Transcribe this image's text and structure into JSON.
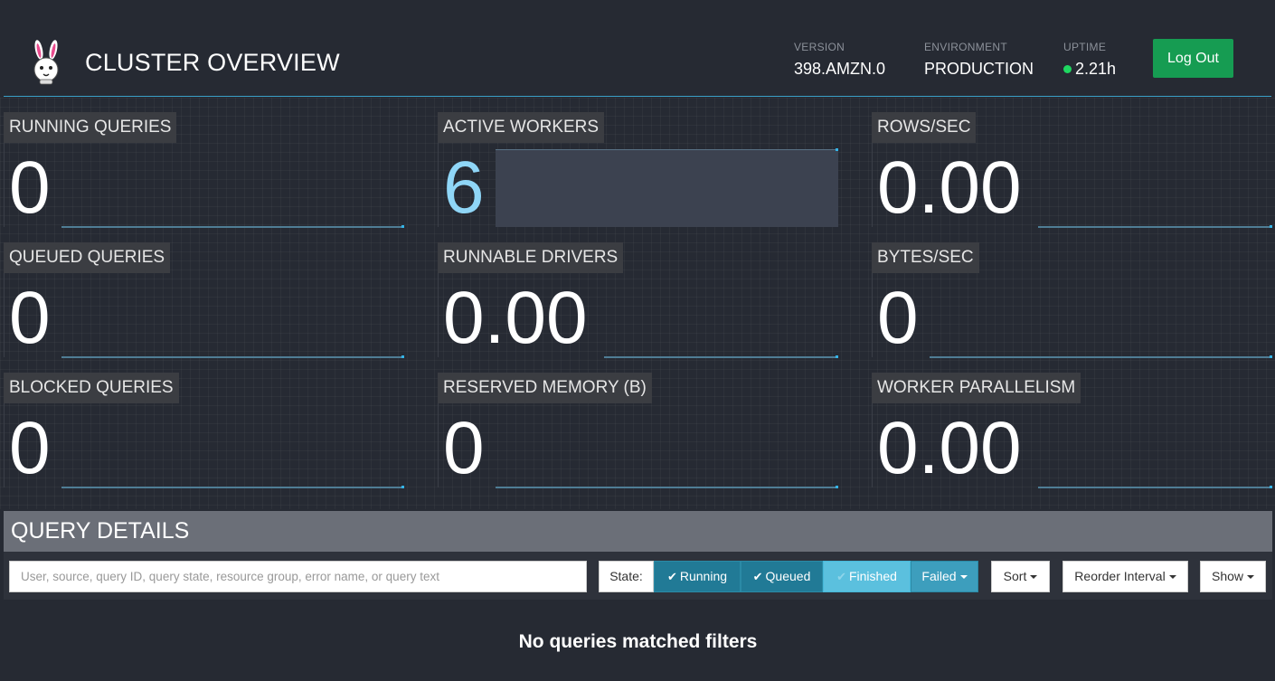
{
  "header": {
    "title": "CLUSTER OVERVIEW",
    "version_label": "VERSION",
    "version_value": "398.AMZN.0",
    "environment_label": "ENVIRONMENT",
    "environment_value": "PRODUCTION",
    "uptime_label": "UPTIME",
    "uptime_value": "2.21h",
    "logout_label": "Log Out",
    "colors": {
      "accent_rule": "#3aa0c8",
      "logout": "#169c52",
      "uptime_dot": "#1ed760"
    }
  },
  "tiles": {
    "running_queries": {
      "label": "RUNNING QUERIES",
      "value": "0"
    },
    "active_workers": {
      "label": "ACTIVE WORKERS",
      "value": "6"
    },
    "rows_sec": {
      "label": "ROWS/SEC",
      "value": "0.00"
    },
    "queued_queries": {
      "label": "QUEUED QUERIES",
      "value": "0"
    },
    "runnable_drivers": {
      "label": "RUNNABLE DRIVERS",
      "value": "0.00"
    },
    "bytes_sec": {
      "label": "BYTES/SEC",
      "value": "0"
    },
    "blocked_queries": {
      "label": "BLOCKED QUERIES",
      "value": "0"
    },
    "reserved_memory": {
      "label": "RESERVED MEMORY (B)",
      "value": "0"
    },
    "worker_parallelism": {
      "label": "WORKER PARALLELISM",
      "value": "0.00"
    }
  },
  "query_details": {
    "title": "QUERY DETAILS",
    "search_placeholder": "User, source, query ID, query state, resource group, error name, or query text",
    "state_label": "State:",
    "state_filters": {
      "running": "Running",
      "queued": "Queued",
      "finished": "Finished",
      "failed": "Failed"
    },
    "sort_label": "Sort",
    "reorder_label": "Reorder Interval",
    "show_label": "Show",
    "empty_message": "No queries matched filters"
  }
}
